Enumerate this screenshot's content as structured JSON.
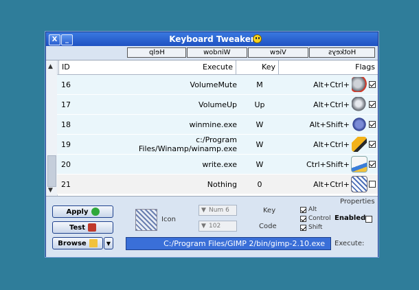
{
  "window": {
    "title": "Keyboard Tweaker",
    "close_glyph": "X",
    "minimize_glyph": "_"
  },
  "menu": [
    {
      "label": "Help"
    },
    {
      "label": "Window"
    },
    {
      "label": "View"
    },
    {
      "label": "Hotkeys"
    }
  ],
  "table": {
    "headers": {
      "id": "ID",
      "execute": "Execute",
      "key": "Key",
      "flags": "Flags"
    },
    "rows": [
      {
        "id": "16",
        "execute": "VolumeMute",
        "key": "M",
        "flags": "Alt+Ctrl+",
        "icon": "volume-mute-icon",
        "enabled": true
      },
      {
        "id": "17",
        "execute": "VolumeUp",
        "key": "Up",
        "flags": "Alt+Ctrl+",
        "icon": "volume-up-icon",
        "enabled": true
      },
      {
        "id": "18",
        "execute": "winmine.exe",
        "key": "W",
        "flags": "Alt+Shift+",
        "icon": "minesweeper-icon",
        "enabled": true
      },
      {
        "id": "19",
        "execute": "c:/Program Files/Winamp/winamp.exe",
        "key": "W",
        "flags": "Alt+Ctrl+",
        "icon": "winamp-icon",
        "enabled": true
      },
      {
        "id": "20",
        "execute": "write.exe",
        "key": "W",
        "flags": "Ctrl+Shift+",
        "icon": "wordpad-icon",
        "enabled": true
      },
      {
        "id": "21",
        "execute": "Nothing",
        "key": "0",
        "flags": "Alt+Ctrl+",
        "icon": "default-icon",
        "enabled": false
      }
    ]
  },
  "properties": {
    "section_label": "Properties",
    "enabled_label": "Enabled",
    "alt_label": "Alt",
    "control_label": "Control",
    "shift_label": "Shift",
    "key_label": "Key",
    "key_value": "Num 6",
    "code_label": "Code",
    "code_value": "102",
    "icon_label": "Icon",
    "execute_label": "Execute:",
    "execute_value": "C:/Program Files/GIMP 2/bin/gimp-2.10.exe"
  },
  "buttons": {
    "apply": "Apply",
    "test": "Test",
    "browse": "Browse"
  },
  "colors": {
    "desktop": "#2f7d9a",
    "titlebar": "#1f52c2",
    "selection": "#3a6fd8",
    "row_bg": "#eaf6fb"
  }
}
